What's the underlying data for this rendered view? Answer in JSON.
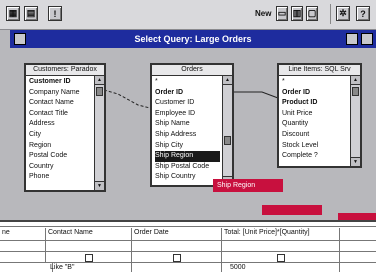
{
  "toolbar": {
    "new_label": "New"
  },
  "window": {
    "title": "Select Query: Large Orders"
  },
  "tables": [
    {
      "name": "Customers: Paradox",
      "fields": [
        "Customer ID",
        "Company Name",
        "Contact Name",
        "Contact Title",
        "Address",
        "City",
        "Region",
        "Postal Code",
        "Country",
        "Phone"
      ],
      "key_fields": [
        "Customer ID"
      ]
    },
    {
      "name": "Orders",
      "fields": [
        "*",
        "Order ID",
        "Customer ID",
        "Employee ID",
        "Ship Name",
        "Ship Address",
        "Ship City",
        "Ship Region",
        "Ship Postal Code",
        "Ship Country"
      ],
      "key_fields": [
        "Order ID"
      ],
      "selected_field": "Ship Region"
    },
    {
      "name": "Line Items: SQL Srv",
      "fields": [
        "*",
        "Order ID",
        "Product ID",
        "Unit Price",
        "Quantity",
        "Discount",
        "Stock Level",
        "Complete ?"
      ],
      "key_fields": [
        "Order ID",
        "Product ID"
      ]
    }
  ],
  "drag_label": "Ship Region",
  "grid": {
    "fields": [
      "ne",
      "Contact Name",
      "Order Date",
      "Total: [Unit Price]*[Quantity]"
    ],
    "criteria": [
      "Like \"B\"",
      "",
      "",
      "5000"
    ]
  }
}
